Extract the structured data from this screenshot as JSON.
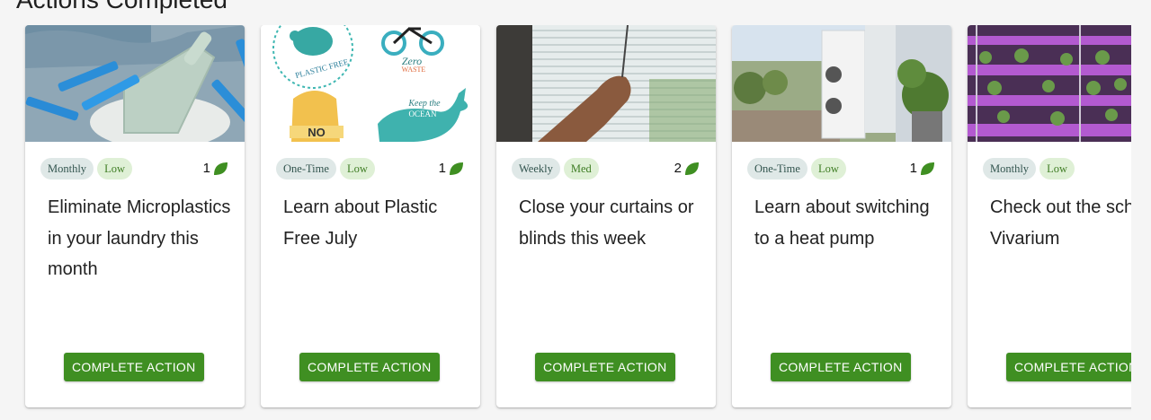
{
  "page": {
    "section_title": "Actions Completed"
  },
  "cards": [
    {
      "frequency": "Monthly",
      "impact": "Low",
      "points": "1",
      "title": "Eliminate Microplastics in your laundry this month",
      "button_label": "COMPLETE ACTION",
      "image": "laundry-powder-scoop-with-blue-pegs"
    },
    {
      "frequency": "One-Time",
      "impact": "Low",
      "points": "1",
      "title": "Learn about Plastic Free July",
      "button_label": "COMPLETE ACTION",
      "image": "plastic-free-zero-waste-stickers",
      "image_text": {
        "plastic_free": "PLASTIC FREE",
        "zero": "Zero",
        "waste": "WASTE",
        "keep_the": "Keep the",
        "ocean": "OCEAN",
        "no": "NO"
      }
    },
    {
      "frequency": "Weekly",
      "impact": "Med",
      "points": "2",
      "title": "Close your curtains or blinds this week",
      "button_label": "COMPLETE ACTION",
      "image": "hand-closing-window-blinds"
    },
    {
      "frequency": "One-Time",
      "impact": "Low",
      "points": "1",
      "title": "Learn about switching to a heat pump",
      "button_label": "COMPLETE ACTION",
      "image": "outdoor-heat-pump-units"
    },
    {
      "frequency": "Monthly",
      "impact": "Low",
      "points": "",
      "title": "Check out the school Vivarium",
      "button_label": "COMPLETE ACTION",
      "image": "vivarium-shelves-purple-grow-lights"
    }
  ],
  "colors": {
    "button": "#3f8f22",
    "leaf": "#3f8f22",
    "chip_frequency": "#dfe8e7",
    "chip_impact": "#dff0d6"
  },
  "icons": {
    "points": "leaf-icon"
  }
}
